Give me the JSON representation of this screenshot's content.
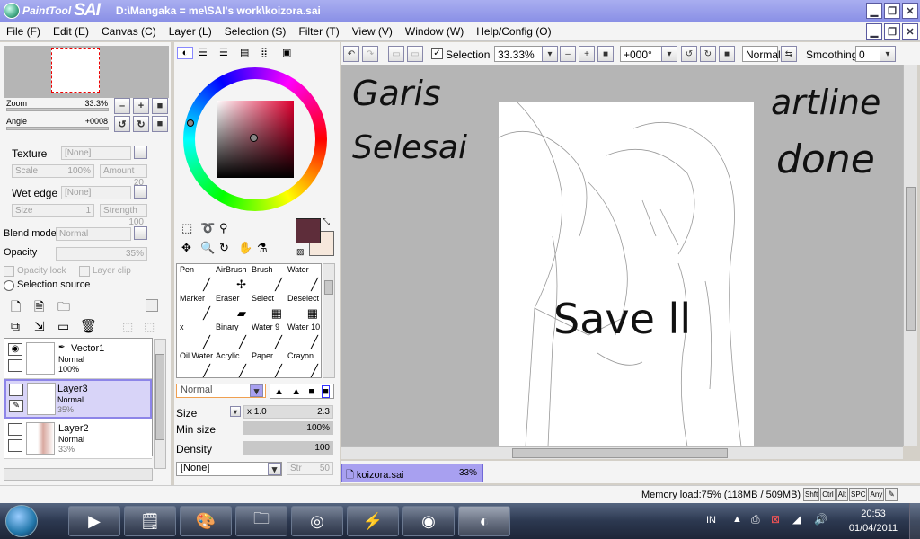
{
  "window": {
    "logo_prefix": "PaintTool",
    "logo_name": "SAI",
    "title": "D:\\Mangaka = me\\SAI's work\\koizora.sai"
  },
  "menu": [
    "File (F)",
    "Edit (E)",
    "Canvas (C)",
    "Layer (L)",
    "Selection (S)",
    "Filter (T)",
    "View (V)",
    "Window (W)",
    "Help/Config (O)"
  ],
  "navigator": {
    "zoom_label": "Zoom",
    "zoom_value": "33.3%",
    "angle_label": "Angle",
    "angle_value": "+0008"
  },
  "properties": {
    "texture_label": "Texture",
    "texture_value": "[None]",
    "scale_label": "Scale",
    "scale_value": "100%",
    "amount_label": "Amount",
    "amount_value": "20",
    "wet_edge_label": "Wet edge",
    "wet_edge_value": "[None]",
    "size_label": "Size",
    "size_value": "1",
    "strength_label": "Strength",
    "strength_value": "100",
    "blend_label": "Blend mode",
    "blend_value": "Normal",
    "opacity_label": "Opacity",
    "opacity_value": "35%",
    "opacity_lock": "Opacity lock",
    "layer_clip": "Layer clip",
    "selection_source": "Selection source"
  },
  "layers": [
    {
      "name": "Vector1",
      "mode": "Normal",
      "opacity": "100%",
      "selected": false
    },
    {
      "name": "Layer3",
      "mode": "Normal",
      "opacity": "35%",
      "selected": true
    },
    {
      "name": "Layer2",
      "mode": "Normal",
      "opacity": "33%",
      "selected": false
    }
  ],
  "tools": [
    {
      "label": "Pen",
      "glyph": "╱"
    },
    {
      "label": "AirBrush",
      "glyph": "✢"
    },
    {
      "label": "Brush",
      "glyph": "╱"
    },
    {
      "label": "Water",
      "glyph": "╱"
    },
    {
      "label": "Marker",
      "glyph": "╱"
    },
    {
      "label": "Eraser",
      "glyph": "▰"
    },
    {
      "label": "Select",
      "glyph": "▦"
    },
    {
      "label": "Deselect",
      "glyph": "▦"
    },
    {
      "label": "x",
      "glyph": "╱"
    },
    {
      "label": "Binary",
      "glyph": "╱"
    },
    {
      "label": "Water 9",
      "glyph": "╱"
    },
    {
      "label": "Water 10",
      "glyph": "╱"
    },
    {
      "label": "Oil Water",
      "glyph": "╱"
    },
    {
      "label": "Acrylic",
      "glyph": "╱"
    },
    {
      "label": "Paper",
      "glyph": "╱"
    },
    {
      "label": "Crayon",
      "glyph": "╱"
    }
  ],
  "brush": {
    "mode": "Normal",
    "size_label": "Size",
    "size_mult": "x 1.0",
    "size_value": "2.3",
    "min_size_label": "Min size",
    "min_size_value": "100%",
    "density_label": "Density",
    "density_value": "100",
    "texture_value": "[None]",
    "strength_label": "Str",
    "strength_value": "50"
  },
  "toolbar": {
    "selection_label": "Selection",
    "zoom_value": "33.33%",
    "angle_value": "+000°",
    "blend_value": "Normal",
    "smoothing_label": "Smoothing",
    "smoothing_value": "0"
  },
  "canvas_text": {
    "garis": "Garis",
    "selesai": "Selesai",
    "artline": "artline",
    "done": "done",
    "save": "Save ll"
  },
  "document_tab": {
    "name": "koizora.sai",
    "zoom": "33%"
  },
  "status": {
    "memory": "Memory load:75% (118MB / 509MB)",
    "keys": [
      "Shft",
      "Ctrl",
      "Alt",
      "SPC",
      "Any"
    ]
  },
  "taskbar": {
    "lang": "IN",
    "time": "20:53",
    "date": "01/04/2011"
  },
  "colors": {
    "primary": "#5e2d3a",
    "secondary": "#f6e8dc",
    "title_bar": "#9aa0ea",
    "selection": "#d8d4f8"
  }
}
